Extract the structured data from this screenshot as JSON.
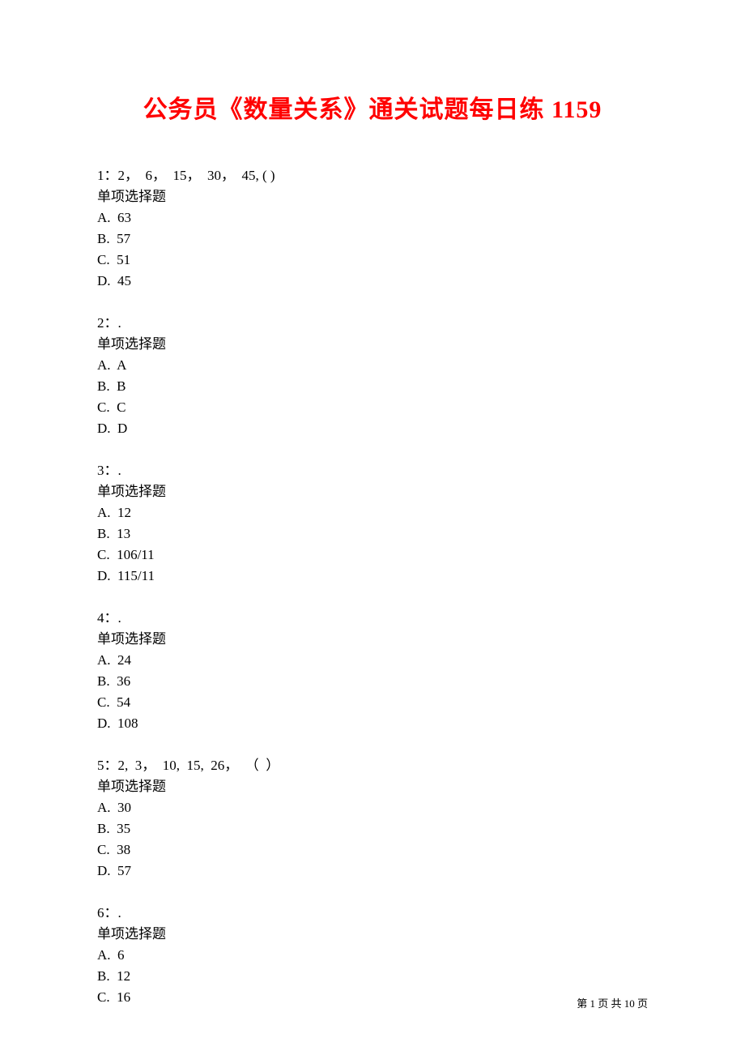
{
  "title": "公务员《数量关系》通关试题每日练 1159",
  "questions": [
    {
      "number": "1：",
      "stem": "2，  6，  15，  30，  45, ( )",
      "type": "单项选择题",
      "options": [
        "A.  63",
        "B.  57",
        "C.  51",
        "D.  45"
      ]
    },
    {
      "number": "2：",
      "stem": ".",
      "type": "单项选择题",
      "options": [
        "A.  A",
        "B.  B",
        "C.  C",
        "D.  D"
      ]
    },
    {
      "number": "3：",
      "stem": ".",
      "type": "单项选择题",
      "options": [
        "A.  12",
        "B.  13",
        "C.  106/11",
        "D.  115/11"
      ]
    },
    {
      "number": "4：",
      "stem": ".",
      "type": "单项选择题",
      "options": [
        "A.  24",
        "B.  36",
        "C.  54",
        "D.  108"
      ]
    },
    {
      "number": "5：",
      "stem": "2,  3，  10,  15,  26，  （  ）",
      "type": "单项选择题",
      "options": [
        "A.  30",
        "B.  35",
        "C.  38",
        "D.  57"
      ]
    },
    {
      "number": "6：",
      "stem": ".",
      "type": "单项选择题",
      "options": [
        "A.  6",
        "B.  12",
        "C.  16"
      ]
    }
  ],
  "footer": {
    "prefix": "第 ",
    "current": "1",
    "mid": " 页 共 ",
    "total": "10",
    "suffix": " 页"
  }
}
